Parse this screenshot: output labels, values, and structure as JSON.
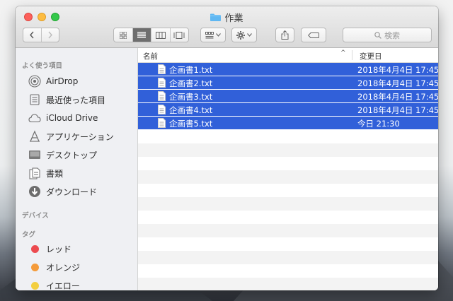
{
  "window": {
    "title": "作業"
  },
  "toolbar": {
    "search_placeholder": "検索"
  },
  "sidebar": {
    "favorites_header": "よく使う項目",
    "favorites": [
      {
        "label": "AirDrop",
        "icon": "airdrop-icon"
      },
      {
        "label": "最近使った項目",
        "icon": "recents-icon"
      },
      {
        "label": "iCloud Drive",
        "icon": "cloud-icon"
      },
      {
        "label": "アプリケーション",
        "icon": "applications-icon"
      },
      {
        "label": "デスクトップ",
        "icon": "desktop-icon"
      },
      {
        "label": "書類",
        "icon": "documents-icon"
      },
      {
        "label": "ダウンロード",
        "icon": "downloads-icon"
      }
    ],
    "devices_header": "デバイス",
    "tags_header": "タグ",
    "tags": [
      {
        "label": "レッド",
        "color": "#ec4a4f"
      },
      {
        "label": "オレンジ",
        "color": "#f49b3a"
      },
      {
        "label": "イエロー",
        "color": "#f3cf40"
      }
    ]
  },
  "list": {
    "col_name": "名前",
    "col_date": "変更日",
    "sort_indicator": "^",
    "files": [
      {
        "name": "企画書1.txt",
        "date": "2018年4月4日 17:45"
      },
      {
        "name": "企画書2.txt",
        "date": "2018年4月4日 17:45"
      },
      {
        "name": "企画書3.txt",
        "date": "2018年4月4日 17:45"
      },
      {
        "name": "企画書4.txt",
        "date": "2018年4月4日 17:45"
      },
      {
        "name": "企画書5.txt",
        "date": "今日 21:30"
      }
    ]
  },
  "colors": {
    "selection": "#3160d9",
    "sidebar_bg": "#eff0f3",
    "accent_folder": "#5fb7f2"
  }
}
